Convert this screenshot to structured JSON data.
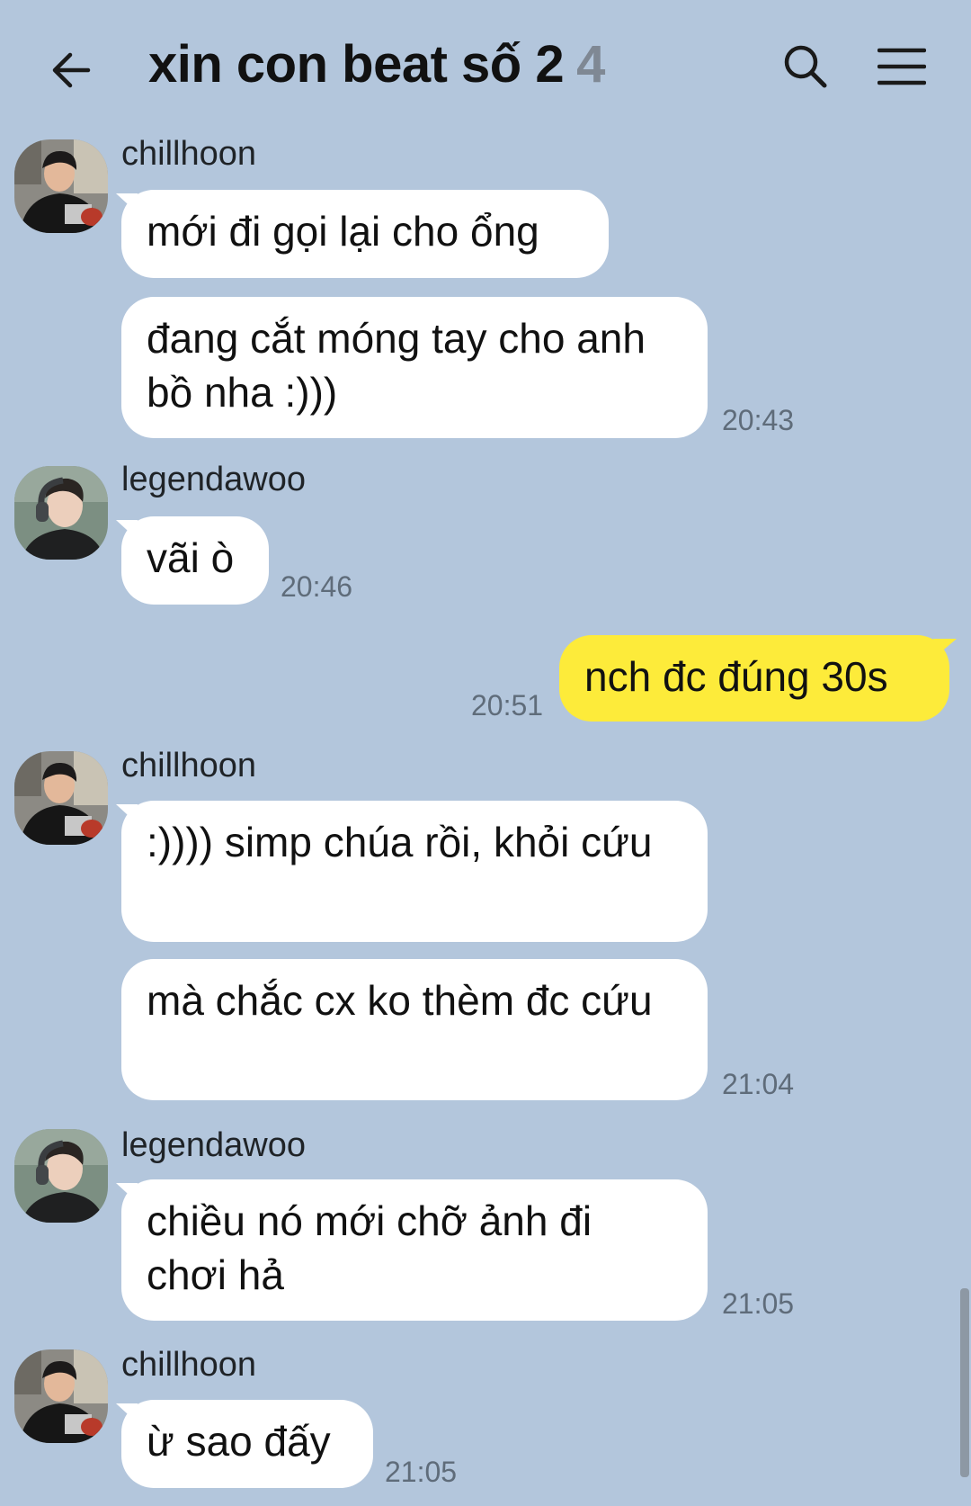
{
  "header": {
    "title": "xin con beat số 2",
    "member_count": "4",
    "back_icon": "arrow-left-icon",
    "search_icon": "search-icon",
    "menu_icon": "hamburger-menu-icon"
  },
  "colors": {
    "background": "#b3c6dc",
    "incoming_bubble": "#ffffff",
    "outgoing_bubble": "#fdeb3a"
  },
  "messages": [
    {
      "sender": "chillhoon",
      "text": "mới đi gọi lại cho ổng"
    },
    {
      "text": "đang cắt móng tay cho anh bồ nha :)))",
      "time": "20:43"
    },
    {
      "sender": "legendawoo",
      "text": "vãi ò",
      "time": "20:46"
    },
    {
      "text": "nch đc đúng 30s",
      "time": "20:51"
    },
    {
      "sender": "chillhoon",
      "text": ":)))) simp chúa rồi, khỏi cứu"
    },
    {
      "text": "mà chắc cx ko thèm đc cứu",
      "time": "21:04"
    },
    {
      "sender": "legendawoo",
      "text": "chiều nó mới chỡ ảnh đi chơi hả",
      "time": "21:05"
    },
    {
      "sender": "chillhoon",
      "text": "ừ sao đấy",
      "time": "21:05"
    }
  ]
}
